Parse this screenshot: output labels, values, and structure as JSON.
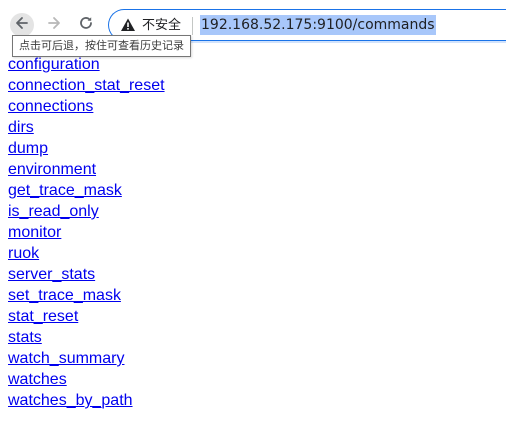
{
  "toolbar": {
    "back_icon": "arrow-left-icon",
    "forward_icon": "arrow-right-icon",
    "reload_icon": "reload-icon"
  },
  "omnibox": {
    "security_icon": "warning-triangle-icon",
    "security_label": "不安全",
    "url": "192.168.52.175:9100/commands"
  },
  "tooltip": {
    "text": "点击可后退，按住可查看历史记录"
  },
  "colors": {
    "link": "#0000ee",
    "selection": "#a8c7fa",
    "focus_ring": "#1a73e8"
  },
  "commands": [
    "configuration",
    "connection_stat_reset",
    "connections",
    "dirs",
    "dump",
    "environment",
    "get_trace_mask",
    "is_read_only",
    "monitor",
    "ruok",
    "server_stats",
    "set_trace_mask",
    "stat_reset",
    "stats",
    "watch_summary",
    "watches",
    "watches_by_path"
  ]
}
